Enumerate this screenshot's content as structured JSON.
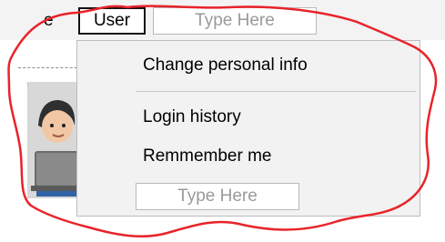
{
  "menubar": {
    "partial_item_label": "e",
    "user_menu_label": "User",
    "type_here_placeholder": "Type Here"
  },
  "dropdown": {
    "items": [
      {
        "label": "Change personal info"
      },
      {
        "label": "Login history"
      },
      {
        "label": "Remmember me"
      }
    ],
    "type_here_placeholder": "Type Here"
  },
  "colors": {
    "annotation_outline": "#e8232a",
    "menu_background": "#f2f2f2",
    "placeholder_text": "#9a9a9a"
  },
  "icons": {
    "avatar": "user-with-laptop-icon"
  }
}
